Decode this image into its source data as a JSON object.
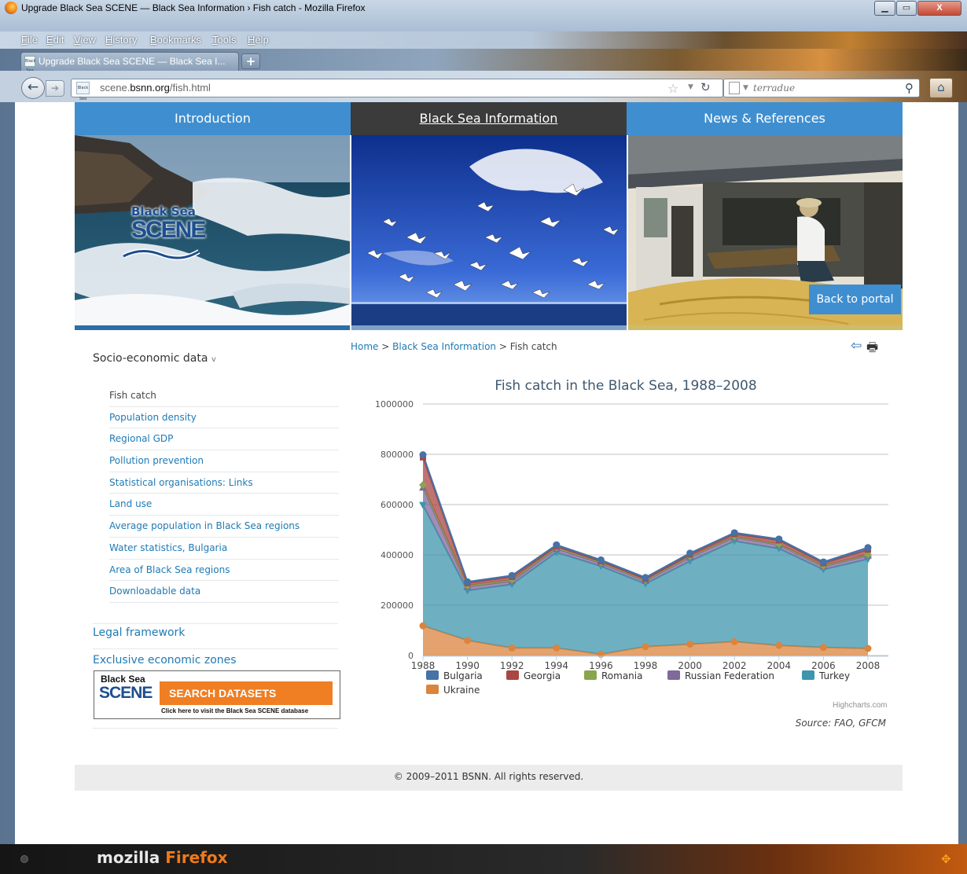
{
  "window": {
    "title": "Upgrade Black Sea SCENE — Black Sea Information › Fish catch - Mozilla Firefox",
    "controls": {
      "minimize": "▁",
      "maximize": "▭",
      "close": "X"
    }
  },
  "menubar": {
    "items": [
      {
        "label": "File"
      },
      {
        "label": "Edit"
      },
      {
        "label": "View"
      },
      {
        "label": "History"
      },
      {
        "label": "Bookmarks"
      },
      {
        "label": "Tools"
      },
      {
        "label": "Help"
      }
    ]
  },
  "tabs": {
    "active_label": "Upgrade Black Sea SCENE — Black Sea I...",
    "new_tab": "+"
  },
  "navbar": {
    "url_prefix": "scene.",
    "url_domain": "bsnn.org",
    "url_path": "/fish.html",
    "search_placeholder": "terradue",
    "favicon_text": "Black Sea SCENE"
  },
  "site": {
    "nav": {
      "intro": "Introduction",
      "bsi": "Black Sea Information",
      "news": "News & References"
    },
    "logo": {
      "line1": "Black Sea",
      "line2": "SCENE"
    },
    "back_to_portal": "Back to portal",
    "sidebar": {
      "section_title": "Socio-economic data",
      "caret": "v",
      "items": [
        {
          "label": "Fish catch"
        },
        {
          "label": "Population density"
        },
        {
          "label": "Regional GDP"
        },
        {
          "label": "Pollution prevention"
        },
        {
          "label": "Statistical organisations: Links"
        },
        {
          "label": "Land use"
        },
        {
          "label": "Average population in Black Sea regions"
        },
        {
          "label": "Water statistics, Bulgaria"
        },
        {
          "label": "Area of Black Sea regions"
        },
        {
          "label": "Downloadable data"
        }
      ],
      "legal": "Legal framework",
      "eez": "Exclusive economic zones",
      "banner": {
        "line1": "Black Sea",
        "line2": "SCENE",
        "search": "SEARCH DATASETS",
        "click": "Click here to visit the Black Sea SCENE database"
      }
    },
    "breadcrumb": {
      "home": "Home",
      "sep": " > ",
      "section": "Black Sea Information",
      "page": "Fish catch"
    },
    "source": "Source: FAO, GFCM",
    "credit": "Highcharts.com",
    "footer": "© 2009–2011 BSNN. All rights reserved."
  },
  "taskbar": {
    "brand_a": "mozilla ",
    "brand_b": "Firefox"
  },
  "colors": {
    "accent": "#3f8fd0",
    "nav_dark": "#3b3b3b",
    "link": "#1f7ab5",
    "bulgaria": "#4572a7",
    "georgia": "#aa4643",
    "romania": "#89a54e",
    "russia": "#80699b",
    "turkey": "#3d96ae",
    "ukraine": "#db843d"
  },
  "chart_data": {
    "type": "area",
    "stacked": true,
    "title": "Fish catch in the Black Sea, 1988–2008",
    "xlabel": "",
    "ylabel": "",
    "ylim": [
      0,
      1000000
    ],
    "yticks": [
      0,
      200000,
      400000,
      600000,
      800000,
      1000000
    ],
    "grid": true,
    "legend": "bottom",
    "x": [
      1988,
      1990,
      1992,
      1994,
      1996,
      1998,
      2000,
      2002,
      2004,
      2006,
      2008
    ],
    "series": [
      {
        "name": "Bulgaria",
        "color": "#4572a7",
        "marker": "circle",
        "values": [
          10000,
          5000,
          5000,
          5000,
          5000,
          5000,
          5000,
          5000,
          5000,
          5000,
          8000
        ]
      },
      {
        "name": "Georgia",
        "color": "#aa4643",
        "marker": "square",
        "values": [
          110000,
          10000,
          12000,
          5000,
          5000,
          5000,
          8000,
          10000,
          15000,
          10000,
          20000
        ]
      },
      {
        "name": "Romania",
        "color": "#89a54e",
        "marker": "diamond",
        "values": [
          10000,
          5000,
          5000,
          5000,
          3000,
          3000,
          3000,
          3000,
          3000,
          3000,
          3000
        ]
      },
      {
        "name": "Russian Federation",
        "color": "#80699b",
        "marker": "triangle",
        "values": [
          70000,
          15000,
          13000,
          15000,
          12000,
          12000,
          16000,
          15000,
          15000,
          12000,
          15000
        ]
      },
      {
        "name": "Turkey",
        "color": "#3d96ae",
        "marker": "triangle-down",
        "values": [
          480000,
          198000,
          253000,
          380000,
          350000,
          250000,
          330000,
          400000,
          385000,
          310000,
          355000
        ]
      },
      {
        "name": "Ukraine",
        "color": "#db843d",
        "marker": "circle",
        "values": [
          118000,
          60000,
          30000,
          30000,
          5000,
          35000,
          45000,
          55000,
          40000,
          32000,
          28000
        ]
      }
    ]
  }
}
